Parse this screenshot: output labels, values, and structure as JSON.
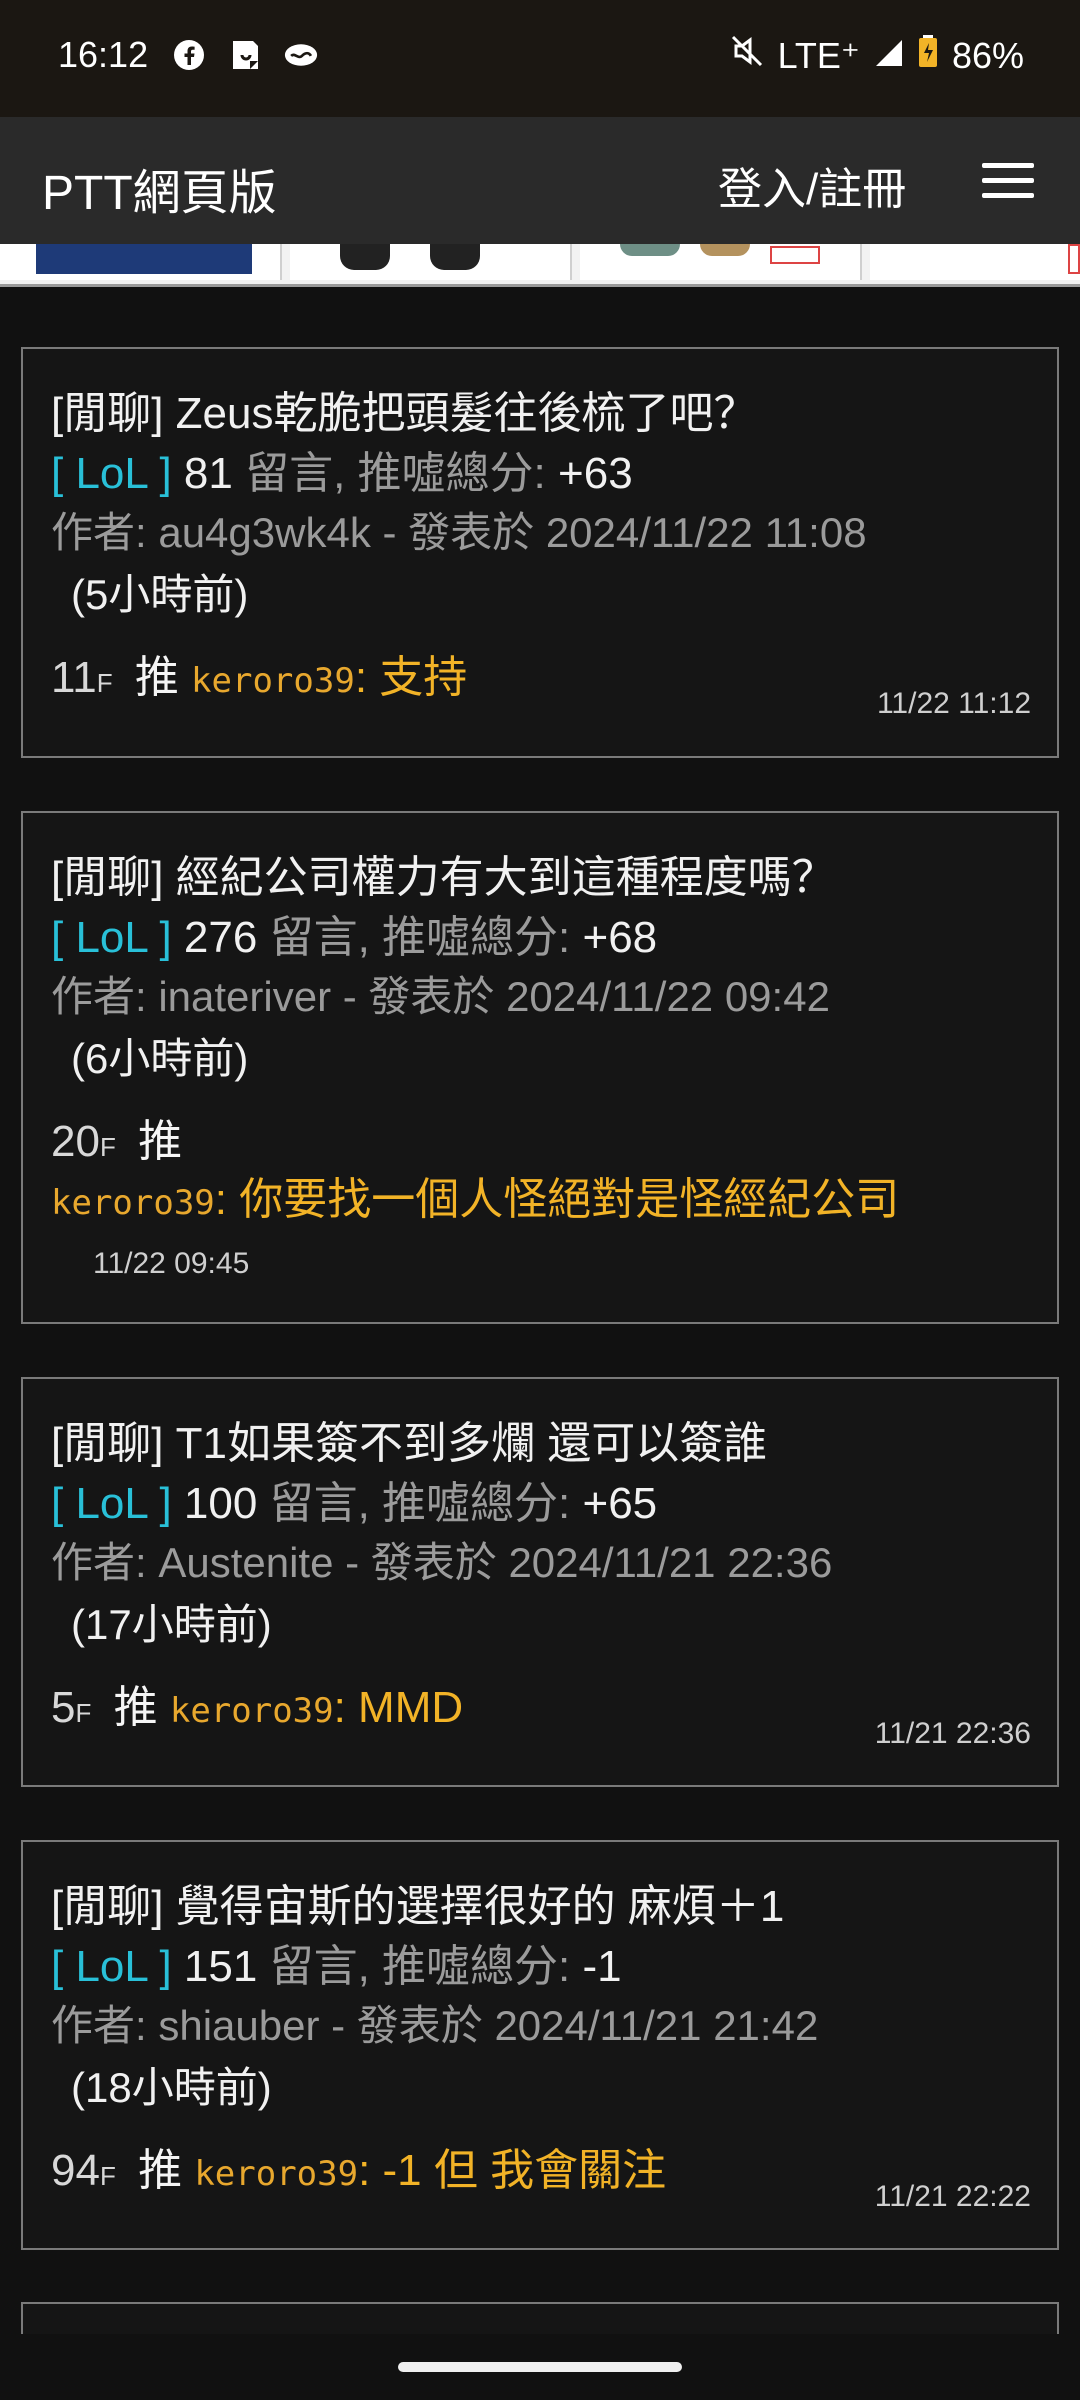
{
  "status": {
    "time": "16:12",
    "network": "LTE⁺",
    "battery": "86%",
    "icons": [
      "facebook-icon",
      "sticky-note-icon",
      "cloud-icon",
      "mute-icon",
      "signal-icon",
      "battery-icon"
    ]
  },
  "header": {
    "brand": "PTT網頁版",
    "login": "登入/註冊"
  },
  "posts": [
    {
      "title": "[閒聊] Zeus乾脆把頭髮往後梳了吧？",
      "board": "[ LoL ]",
      "comments": "81",
      "comments_label": "留言, 推噓總分:",
      "score": "+63",
      "author": "作者: au4g3wk4k - 發表於 2024/11/22 11:08",
      "ago": "(5小時前)",
      "floor": "11",
      "floor_suffix": "F",
      "push": "推",
      "user": "keroro39",
      "text": ": 支持",
      "date": "11/22 11:12"
    },
    {
      "title": "[閒聊] 經紀公司權力有大到這種程度嗎？",
      "board": "[ LoL ]",
      "comments": "276",
      "comments_label": "留言, 推噓總分:",
      "score": "+68",
      "author": "作者: inateriver - 發表於 2024/11/22 09:42",
      "ago": "(6小時前)",
      "floor": "20",
      "floor_suffix": "F",
      "push": "推",
      "user": "keroro39",
      "text": ": 你要找一個人怪絕對是怪經紀公司",
      "date": "11/22 09:45"
    },
    {
      "title": "[閒聊] T1如果簽不到多爛 還可以簽誰",
      "board": "[ LoL ]",
      "comments": "100",
      "comments_label": "留言, 推噓總分:",
      "score": "+65",
      "author": "作者: Austenite - 發表於 2024/11/21 22:36",
      "ago": "(17小時前)",
      "floor": "5",
      "floor_suffix": "F",
      "push": "推",
      "user": "keroro39",
      "text": ": MMD",
      "date": "11/21 22:36"
    },
    {
      "title": "[閒聊] 覺得宙斯的選擇很好的 麻煩＋1",
      "board": "[ LoL ]",
      "comments": "151",
      "comments_label": "留言, 推噓總分:",
      "score": "-1",
      "author": "作者: shiauber - 發表於 2024/11/21 21:42",
      "ago": "(18小時前)",
      "floor": "94",
      "floor_suffix": "F",
      "push": "推",
      "user": "keroro39",
      "text": ": -1 但 我會關注",
      "date": "11/21 22:22"
    }
  ]
}
